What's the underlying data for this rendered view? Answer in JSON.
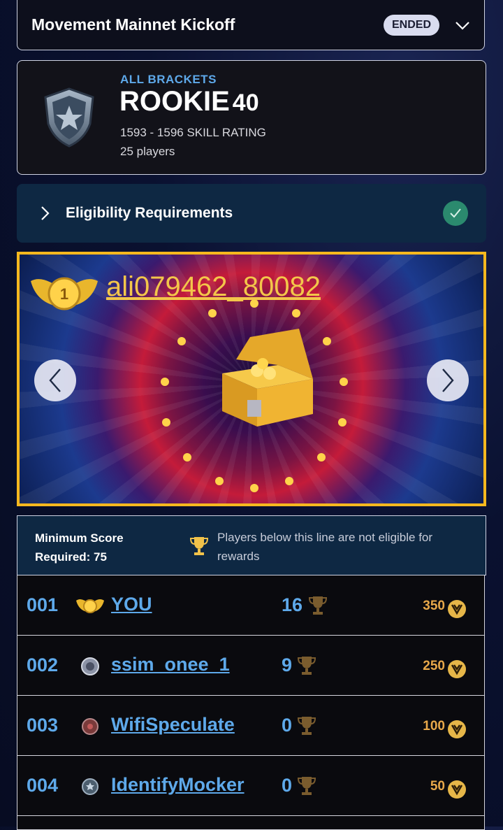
{
  "header": {
    "title": "Movement Mainnet Kickoff",
    "status": "ENDED"
  },
  "bracket": {
    "category": "ALL BRACKETS",
    "name": "ROOKIE",
    "number": "40",
    "skill_range": "1593 - 1596 SKILL RATING",
    "players": "25 players"
  },
  "eligibility": {
    "label": "Eligibility Requirements",
    "met": true
  },
  "banner": {
    "winner": "ali079462_80082",
    "place": "1"
  },
  "min_score": {
    "line1": "Minimum Score",
    "line2": "Required: 75",
    "note": "Players below this line are not eligible for rewards"
  },
  "leaderboard": [
    {
      "rank": "001",
      "name": "YOU",
      "score": "16",
      "reward": "350",
      "medal": "gold-wings-medal-icon"
    },
    {
      "rank": "002",
      "name": "ssim_onee_1",
      "score": "9",
      "reward": "250",
      "medal": "silver-badge-icon"
    },
    {
      "rank": "003",
      "name": "WifiSpeculate",
      "score": "0",
      "reward": "100",
      "medal": "bronze-badge-icon"
    },
    {
      "rank": "004",
      "name": "IdentifyMocker",
      "score": "0",
      "reward": "50",
      "medal": "steel-badge-icon"
    }
  ],
  "colors": {
    "accent": "#5ea9ea",
    "gold": "#f7b81e",
    "reward": "#e8a84a"
  }
}
